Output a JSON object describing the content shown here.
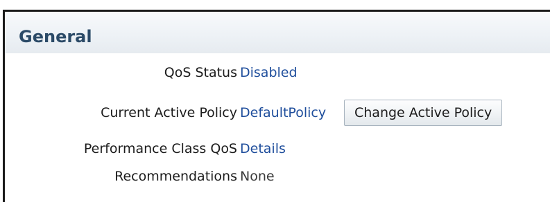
{
  "section": {
    "title": "General"
  },
  "fields": {
    "qos_status": {
      "label": "QoS Status",
      "value": "Disabled"
    },
    "current_active_policy": {
      "label": "Current Active Policy",
      "value": "DefaultPolicy"
    },
    "change_policy_button": "Change Active Policy",
    "performance_class_qos": {
      "label": "Performance Class QoS",
      "value": "Details"
    },
    "recommendations": {
      "label": "Recommendations",
      "value": "None"
    }
  },
  "colors": {
    "title": "#2b4a67",
    "link": "#1f4e9c",
    "label": "#1c1c1c",
    "plain_value": "#3a3a3a"
  }
}
